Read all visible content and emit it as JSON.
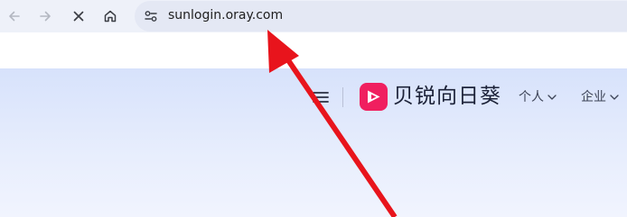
{
  "browser": {
    "url": "sunlogin.oray.com",
    "icons": {
      "back": "arrow-left-icon",
      "forward": "arrow-right-icon",
      "stop": "close-icon",
      "home": "home-icon",
      "site_info": "tune-icon"
    }
  },
  "page": {
    "brand_name": "贝锐向日葵",
    "logo_color": "#f01f5f",
    "menu_icon": "hamburger-icon",
    "nav": [
      {
        "label": "个人"
      },
      {
        "label": "企业"
      }
    ]
  },
  "annotation": {
    "color": "#e8141c",
    "icon": "red-arrow-icon"
  }
}
